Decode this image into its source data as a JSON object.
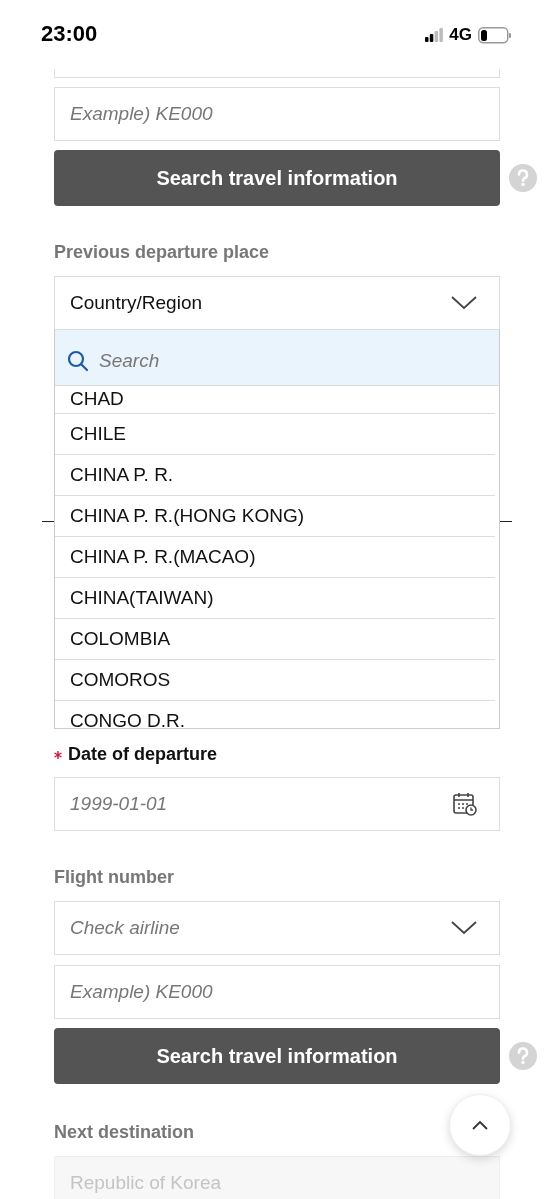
{
  "status_bar": {
    "time": "23:00",
    "network": "4G"
  },
  "top_section": {
    "number_placeholder": "Example) KE000",
    "search_button": "Search travel information"
  },
  "previous_departure": {
    "label": "Previous departure place",
    "select_value": "Country/Region",
    "dropdown": {
      "expanded": true,
      "search_placeholder": "Search",
      "options": [
        {
          "label": "CHAD"
        },
        {
          "label": "CHILE"
        },
        {
          "label": "CHINA P. R."
        },
        {
          "label": "CHINA P. R.(HONG KONG)"
        },
        {
          "label": "CHINA P. R.(MACAO)"
        },
        {
          "label": "CHINA(TAIWAN)"
        },
        {
          "label": "COLOMBIA"
        },
        {
          "label": "COMOROS"
        },
        {
          "label": "CONGO D.R."
        }
      ]
    }
  },
  "departure_date": {
    "label": "Date of departure",
    "required": true,
    "placeholder": "1999-01-01"
  },
  "flight_number": {
    "label": "Flight number",
    "airline_placeholder": "Check airline",
    "number_placeholder": "Example) KE000",
    "search_button": "Search travel information"
  },
  "next_destination": {
    "label": "Next destination",
    "value": "Republic of Korea",
    "disabled": true
  }
}
